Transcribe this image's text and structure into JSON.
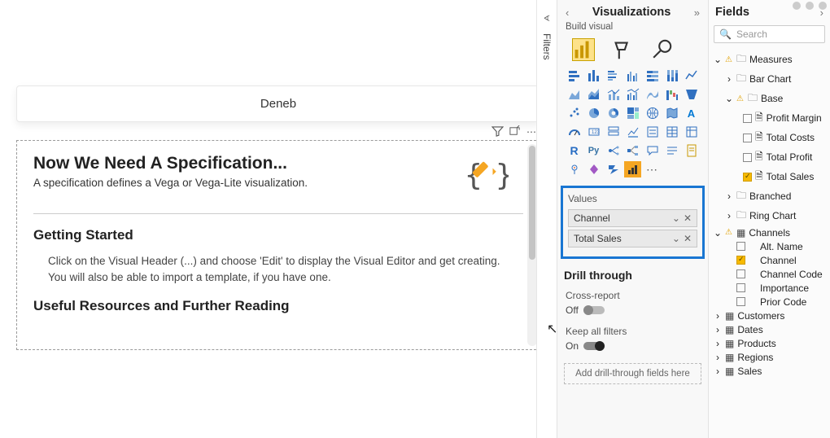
{
  "canvas": {
    "visual_title": "Deneb",
    "spec_heading": "Now We Need A Specification...",
    "spec_sub": "A specification defines a Vega or Vega-Lite visualization.",
    "getting_started_heading": "Getting Started",
    "getting_started_body": "Click on the Visual Header (...) and choose 'Edit' to display the Visual Editor and get creating. You will also be able to import a template, if you have one.",
    "resources_heading": "Useful Resources and Further Reading"
  },
  "filters": {
    "label": "Filters"
  },
  "viz": {
    "title": "Visualizations",
    "sub": "Build visual",
    "values_label": "Values",
    "wells": [
      {
        "name": "Channel"
      },
      {
        "name": "Total Sales"
      }
    ],
    "drill_title": "Drill through",
    "cross_report_label": "Cross-report",
    "off_label": "Off",
    "keep_filters_label": "Keep all filters",
    "on_label": "On",
    "drill_placeholder": "Add drill-through fields here"
  },
  "fields": {
    "title": "Fields",
    "search_placeholder": "Search",
    "tree": {
      "measures": "Measures",
      "bar_chart": "Bar Chart",
      "base": "Base",
      "profit_margin": "Profit Margin",
      "total_costs": "Total Costs",
      "total_profit": "Total Profit",
      "total_sales": "Total Sales",
      "branched": "Branched",
      "ring_chart": "Ring Chart",
      "channels": "Channels",
      "alt_name": "Alt. Name",
      "channel": "Channel",
      "channel_code": "Channel Code",
      "importance": "Importance",
      "prior_code": "Prior Code",
      "customers": "Customers",
      "dates": "Dates",
      "products": "Products",
      "regions": "Regions",
      "sales": "Sales"
    }
  }
}
